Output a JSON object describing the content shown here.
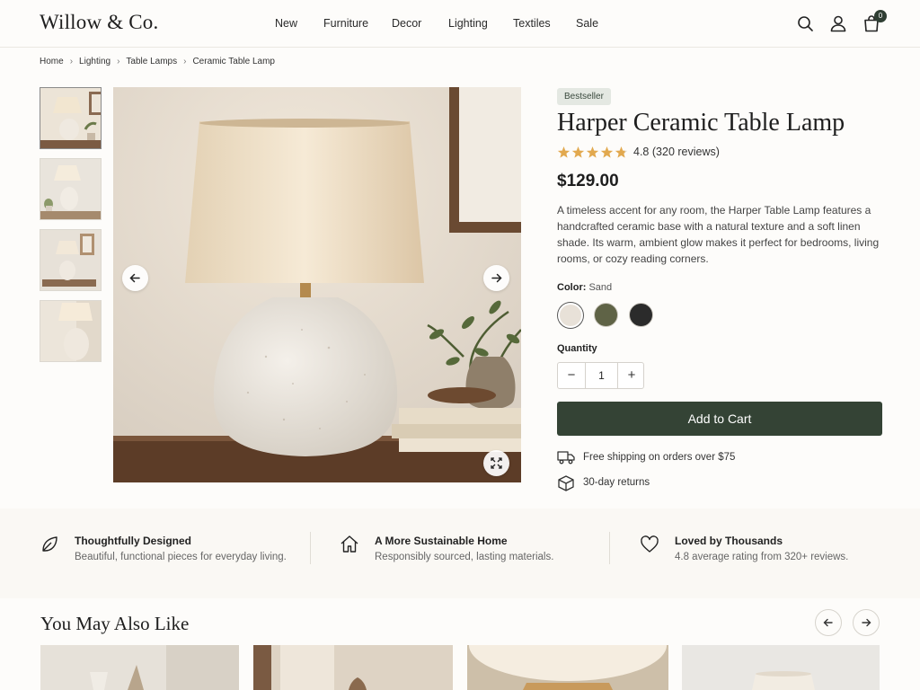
{
  "brand": "Willow & Co.",
  "nav": [
    "New",
    "Furniture",
    "Decor",
    "Lighting",
    "Textiles",
    "Sale"
  ],
  "header_icons": [
    "search-icon",
    "account-icon",
    "bag-icon"
  ],
  "cart_count": "0",
  "breadcrumb": [
    "Home",
    "Lighting",
    "Table Lamps",
    "Ceramic Table Lamp"
  ],
  "product": {
    "badge": "Bestseller",
    "title": "Harper Ceramic Table Lamp",
    "rating_value": 4.8,
    "rating": "4.8",
    "reviews": "(320 reviews)",
    "price": "$129.00",
    "description": "A timeless accent for any room, the Harper Table Lamp features a handcrafted ceramic base with a natural texture and a soft linen shade. Its warm, ambient glow makes it perfect for bedrooms, living rooms, or cozy reading corners.",
    "color_label": "Color:",
    "color_value": "Sand",
    "colors": [
      "#e8e1d8",
      "#5f6346",
      "#2b2b2b"
    ],
    "quantity_label": "Quantity",
    "quantity": "1",
    "add_to_cart": "Add to Cart",
    "perks": [
      "Free shipping on orders over $75",
      "30-day returns"
    ]
  },
  "features": [
    {
      "icon": "leaf-icon",
      "title": "Thoughtfully Designed",
      "sub": "Beautiful, functional pieces for everyday living."
    },
    {
      "icon": "home-icon",
      "title": "A More Sustainable Home",
      "sub": "Responsibly sourced, lasting materials."
    },
    {
      "icon": "heart-icon",
      "title": "Loved by Thousands",
      "sub": "4.8 average rating from 320+ reviews."
    }
  ],
  "recommendations_title": "You May Also Like",
  "colors": {
    "accent": "#344335",
    "badge_bg": "#e4e8e2",
    "star": "#e2a94f",
    "background": "#fdfcfa"
  }
}
